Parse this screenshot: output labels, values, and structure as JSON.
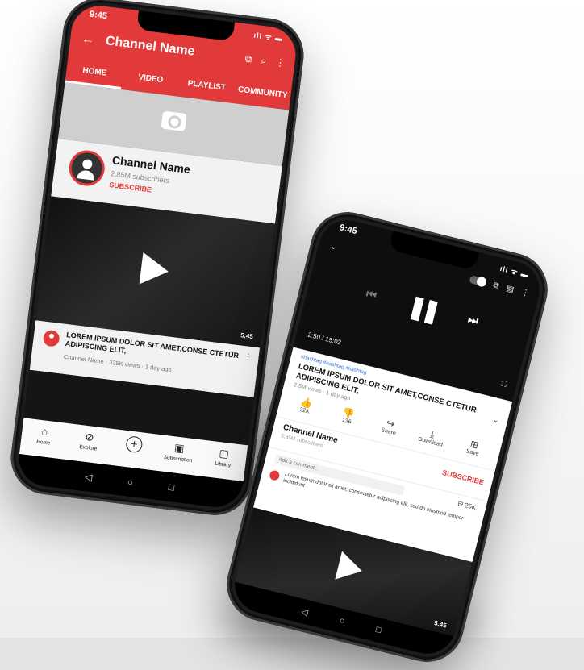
{
  "colors": {
    "brand_red": "#e23a3a",
    "hashtag_blue": "#3a74d8"
  },
  "phone1": {
    "status": {
      "time": "9:45",
      "icons": "ıll ᯤ ▬"
    },
    "appbar": {
      "back_icon": "←",
      "title": "Channel Name",
      "cast_icon": "⧉",
      "search_icon": "⌕",
      "more_icon": "⋮"
    },
    "tabs": [
      "HOME",
      "VIDEO",
      "PLAYLIST",
      "COMMUNITY"
    ],
    "channel": {
      "name": "Channel Name",
      "subscribers": "2,85M subscribers",
      "subscribe_label": "SUBSCRIBE"
    },
    "video": {
      "duration": "5.45",
      "title": "LOREM IPSUM DOLOR SIT AMET,CONSE CTETUR ADIPISCING ELIT,",
      "meta": "Channel Name · 325K views · 1 day ago",
      "more_icon": "⋮"
    },
    "bottom_nav": [
      {
        "label": "Home",
        "icon": "⌂"
      },
      {
        "label": "Explore",
        "icon": "⊘"
      },
      {
        "label": "",
        "icon": "+"
      },
      {
        "label": "Subscription",
        "icon": "▣"
      },
      {
        "label": "Library",
        "icon": "▢"
      }
    ],
    "system_nav": [
      "◁",
      "○",
      "□"
    ]
  },
  "phone2": {
    "status": {
      "time": "9:45",
      "icons": "ıll ᯤ ▬"
    },
    "player": {
      "collapse_icon": "⌄",
      "prev_icon": "⏮",
      "pause_icon": "❚❚",
      "next_icon": "⏭",
      "time": "2:50 / 15:02",
      "fullscreen_icon": "⛶",
      "cast_icon": "⧉",
      "cc_icon": "▤",
      "more_icon": "⋮"
    },
    "details": {
      "hashtags": "#hashtag #hashtag #hashtag",
      "title": "LOREM IPSUM DOLOR SIT AMET,CONSE CTETUR ADIPISCING ELIT,",
      "views": "2.5M views · 1 day ago",
      "expand_icon": "⌄",
      "actions": [
        {
          "label": "32K",
          "icon": "👍"
        },
        {
          "label": "136",
          "icon": "👎"
        },
        {
          "label": "Share",
          "icon": "↪"
        },
        {
          "label": "Download",
          "icon": "⤓"
        },
        {
          "label": "Save",
          "icon": "⊞"
        }
      ]
    },
    "channel": {
      "name": "Channel Name",
      "subscribers": "5,85M subscribers",
      "subscribe_label": "SUBSCRIBE"
    },
    "comments": {
      "placeholder": "Add a comment...",
      "count": "25K",
      "count_icon": "⊟",
      "text": "Lorem ipsum dolor sit amet, consectetur adipiscing elit, sed do eiusmod tempor incididunt"
    },
    "video": {
      "duration": "5.45"
    },
    "system_nav": [
      "◁",
      "○",
      "□"
    ]
  }
}
